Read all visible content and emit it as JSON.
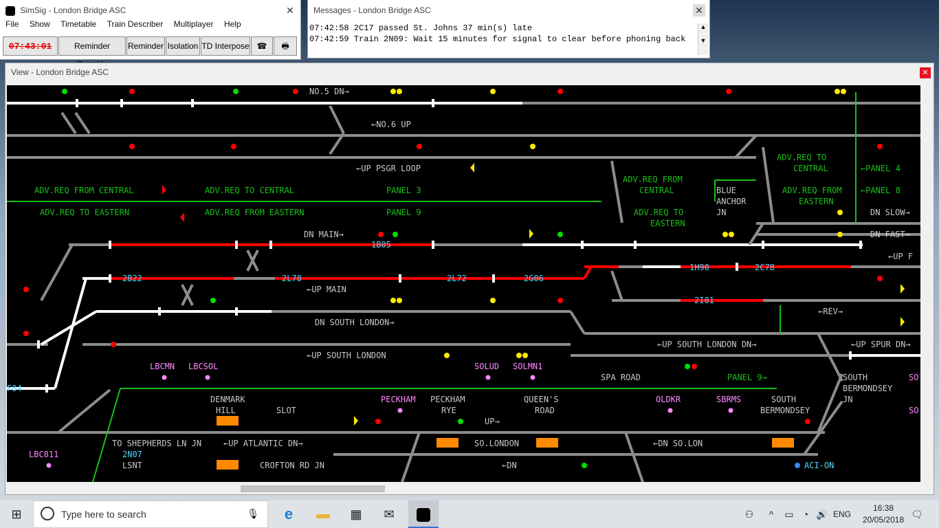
{
  "main_window": {
    "title": "SimSig - London Bridge ASC",
    "menu": [
      "File",
      "Show",
      "Timetable",
      "Train Describer",
      "Multiplayer",
      "Help"
    ],
    "clock": "07:43:01",
    "buttons": [
      "Reminder Override",
      "Reminder",
      "Isolation",
      "TD Interpose"
    ]
  },
  "messages_window": {
    "title": "Messages - London Bridge ASC",
    "lines": [
      "07:42:58 2C17 passed St. Johns 37 min(s) late",
      "07:42:59 Train 2N09: Wait 15 minutes for signal to clear before phoning back"
    ]
  },
  "view_window": {
    "title": "View - London Bridge ASC"
  },
  "panel": {
    "line_labels": [
      "NO.5 DN→",
      "←NO.6 UP",
      "←UP PSGR LOOP",
      "DN MAIN→",
      "←UP MAIN",
      "DN SOUTH LONDON→",
      "←UP SOUTH LONDON",
      "←UP SOUTH LONDON DN→",
      "←UP SPUR DN→",
      "DN SLOW→",
      "DN FAST→",
      "←UP F",
      "←REV→",
      "UP→",
      "←DN",
      "←DN SO.LON",
      "SO.LONDON",
      "←UP ATLANTIC DN→",
      "TO SHEPHERDS LN JN",
      "CROFTON RD JN",
      "LSNT"
    ],
    "green_labels": [
      "ADV.REQ FROM CENTRAL",
      "ADV.REQ TO EASTERN",
      "ADV.REQ TO CENTRAL",
      "ADV.REQ FROM EASTERN",
      "PANEL 3",
      "PANEL 9",
      "ADV.REQ FROM",
      "CENTRAL",
      "ADV.REQ TO",
      "EASTERN",
      "ADV.REQ TO",
      "CENTRAL",
      "ADV.REQ FROM",
      "EASTERN",
      "←PANEL 4",
      "←PANEL 8",
      "PANEL 9→"
    ],
    "place_labels": [
      "BLUE",
      "ANCHOR",
      "JN",
      "SPA ROAD",
      "DENMARK",
      "HILL",
      "SLOT",
      "PECKHAM",
      "RYE",
      "QUEEN'S",
      "ROAD",
      "SOUTH",
      "BERMONDSEY",
      "SOUTH",
      "BERMONDSEY",
      "JN"
    ],
    "berths": [
      "1B05",
      "2B22",
      "2L70",
      "2L72",
      "2G06",
      "1H90",
      "2C78",
      "2I81",
      "F04",
      "2N07"
    ],
    "timing_points": [
      "LBCMN",
      "LBCSOL",
      "SOLUD",
      "SOLMN1",
      "PECKHAM",
      "OLDKR",
      "SBRMS",
      "LBC811",
      "SO",
      "SO"
    ],
    "aci_label": "ACI-ON"
  },
  "colors": {
    "track": "#8c8c8c",
    "route": "#ffffff",
    "occupied": "#ff0000",
    "label": "#c8c8c8",
    "green": "#16c116",
    "berth": "#4dd8ff",
    "pink": "#ff88ff",
    "blue": "#3b8cff",
    "yellow": "#ffea00",
    "orange": "#ff8a00"
  },
  "taskbar": {
    "search_placeholder": "Type here to search",
    "language": "ENG",
    "time": "16:38",
    "date": "20/05/2018"
  }
}
